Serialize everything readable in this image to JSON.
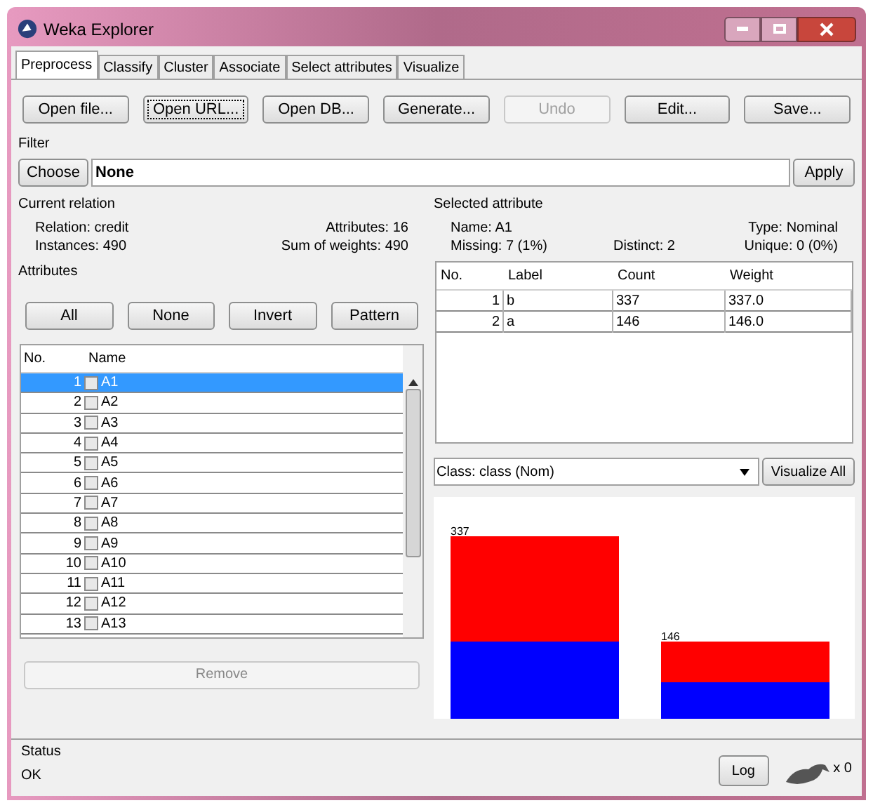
{
  "window": {
    "title": "Weka Explorer"
  },
  "tabs": [
    {
      "label": "Preprocess",
      "selected": true
    },
    {
      "label": "Classify",
      "selected": false
    },
    {
      "label": "Cluster",
      "selected": false
    },
    {
      "label": "Associate",
      "selected": false
    },
    {
      "label": "Select attributes",
      "selected": false
    },
    {
      "label": "Visualize",
      "selected": false
    }
  ],
  "toolbar": [
    {
      "label": "Open file...",
      "disabled": false,
      "focused": false
    },
    {
      "label": "Open URL...",
      "disabled": false,
      "focused": true
    },
    {
      "label": "Open DB...",
      "disabled": false,
      "focused": false
    },
    {
      "label": "Generate...",
      "disabled": false,
      "focused": false
    },
    {
      "label": "Undo",
      "disabled": true,
      "focused": false
    },
    {
      "label": "Edit...",
      "disabled": false,
      "focused": false
    },
    {
      "label": "Save...",
      "disabled": false,
      "focused": false
    }
  ],
  "filter": {
    "title": "Filter",
    "button": "Choose",
    "value": "None",
    "apply": "Apply"
  },
  "current_relation": {
    "title": "Current relation",
    "rows": [
      [
        {
          "label": "Relation:",
          "value": "credit"
        },
        {
          "label": "Attributes:",
          "value": "16"
        }
      ],
      [
        {
          "label": "Instances:",
          "value": "490"
        },
        {
          "label": "Sum of weights:",
          "value": "490"
        }
      ]
    ]
  },
  "attributes": {
    "title": "Attributes",
    "buttons": [
      "All",
      "None",
      "Invert",
      "Pattern"
    ],
    "columns": [
      "No.",
      "Name"
    ],
    "rows": [
      {
        "no": "1",
        "name": "A1",
        "checked": false,
        "selected": true
      },
      {
        "no": "2",
        "name": "A2",
        "checked": false,
        "selected": false
      },
      {
        "no": "3",
        "name": "A3",
        "checked": false,
        "selected": false
      },
      {
        "no": "4",
        "name": "A4",
        "checked": false,
        "selected": false
      },
      {
        "no": "5",
        "name": "A5",
        "checked": false,
        "selected": false
      },
      {
        "no": "6",
        "name": "A6",
        "checked": false,
        "selected": false
      },
      {
        "no": "7",
        "name": "A7",
        "checked": false,
        "selected": false
      },
      {
        "no": "8",
        "name": "A8",
        "checked": false,
        "selected": false
      },
      {
        "no": "9",
        "name": "A9",
        "checked": false,
        "selected": false
      },
      {
        "no": "10",
        "name": "A10",
        "checked": false,
        "selected": false
      },
      {
        "no": "11",
        "name": "A11",
        "checked": false,
        "selected": false
      },
      {
        "no": "12",
        "name": "A12",
        "checked": false,
        "selected": false
      },
      {
        "no": "13",
        "name": "A13",
        "checked": false,
        "selected": false
      }
    ],
    "remove": {
      "label": "Remove",
      "disabled": true
    }
  },
  "selected_attribute": {
    "title": "Selected attribute",
    "rows": [
      [
        {
          "label": "Name:",
          "value": "A1"
        },
        "",
        {
          "label": "Type:",
          "value": "Nominal"
        }
      ],
      [
        {
          "label": "Missing:",
          "value": "7 (1%)"
        },
        {
          "label": "Distinct:",
          "value": "2"
        },
        {
          "label": "Unique:",
          "value": "0 (0%)"
        }
      ]
    ],
    "table": {
      "columns": [
        "No.",
        "Label",
        "Count",
        "Weight"
      ],
      "rows": [
        [
          "1",
          "b",
          "337",
          "337.0"
        ],
        [
          "2",
          "a",
          "146",
          "146.0"
        ]
      ]
    }
  },
  "class_select": {
    "value": "Class: class (Nom)"
  },
  "visualize_all": "Visualize All",
  "class_histogram": {
    "bar_labels": [
      "337",
      "146"
    ]
  },
  "status": {
    "title": "Status",
    "message": "OK",
    "log": "Log",
    "count": "x 0"
  }
}
